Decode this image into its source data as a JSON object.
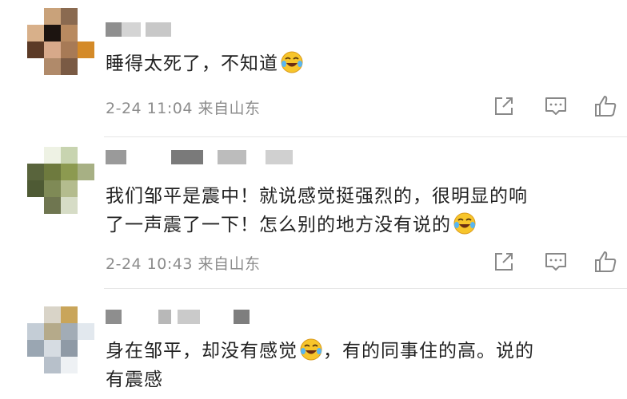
{
  "comments": [
    {
      "text": "睡得太死了，不知道",
      "date": "2-24 11:04",
      "location": "来自山东",
      "emoji": "laugh-cry"
    },
    {
      "text_line1": "我们邹平是震中！就说感觉挺强烈的，很明显的响",
      "text_line2": "了一声震了一下！怎么别的地方没有说的",
      "date": "2-24 10:43",
      "location": "来自山东",
      "emoji": "laugh-cry"
    },
    {
      "text_line1a": "身在邹平，却没有感觉",
      "text_line1b": "，有的同事住的高。说的",
      "text_line2": "有震感",
      "emoji": "laugh-cry"
    }
  ],
  "icons": {
    "share": "share-icon",
    "comment": "comment-icon",
    "like": "thumbs-up-icon"
  },
  "colors": {
    "text": "#222222",
    "meta": "#8c8c8c",
    "icon": "#888888",
    "divider": "#e6e6e6",
    "emoji_face": "#f7c52b"
  }
}
